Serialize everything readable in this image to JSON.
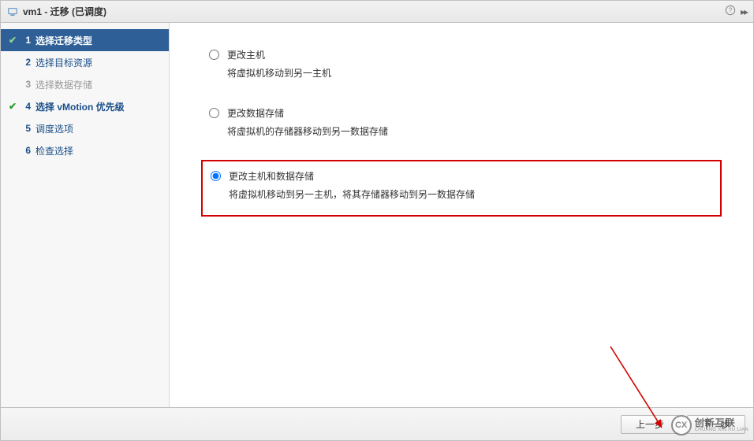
{
  "titlebar": {
    "title": "vm1 - 迁移 (已调度)"
  },
  "sidebar": {
    "steps": [
      {
        "num": "1",
        "label": "选择迁移类型",
        "checked": true,
        "active": true
      },
      {
        "num": "2",
        "label": "选择目标资源",
        "checked": false,
        "active": false
      },
      {
        "num": "3",
        "label": "选择数据存储",
        "checked": false,
        "active": false,
        "disabled": true
      },
      {
        "num": "4",
        "label": "选择 vMotion 优先级",
        "checked": true,
        "active": false
      },
      {
        "num": "5",
        "label": "调度选项",
        "checked": false,
        "active": false
      },
      {
        "num": "6",
        "label": "检查选择",
        "checked": false,
        "active": false
      }
    ]
  },
  "content": {
    "options": [
      {
        "title": "更改主机",
        "desc": "将虚拟机移动到另一主机",
        "selected": false
      },
      {
        "title": "更改数据存储",
        "desc": "将虚拟机的存储器移动到另一数据存储",
        "selected": false
      },
      {
        "title": "更改主机和数据存储",
        "desc": "将虚拟机移动到另一主机，将其存储器移动到另一数据存储",
        "selected": true,
        "highlighted": true
      }
    ]
  },
  "footer": {
    "back": "上一步",
    "next": "下一步",
    "watermark": {
      "main": "创新互联",
      "sub": "CHUANG XIN HU LIAN"
    }
  }
}
